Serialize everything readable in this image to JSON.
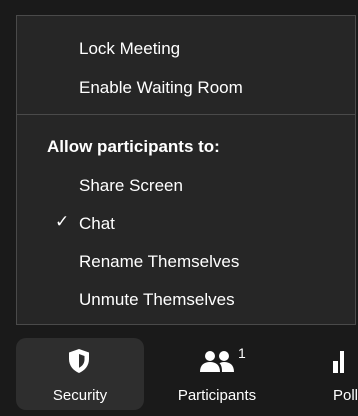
{
  "security_menu": {
    "items_top": [
      {
        "label": "Lock Meeting"
      },
      {
        "label": "Enable Waiting Room"
      }
    ],
    "section_title": "Allow participants to:",
    "permissions": [
      {
        "label": "Share Screen",
        "checked": false
      },
      {
        "label": "Chat",
        "checked": true
      },
      {
        "label": "Rename Themselves",
        "checked": false
      },
      {
        "label": "Unmute Themselves",
        "checked": false
      }
    ],
    "check_mark": "✓"
  },
  "toolbar": {
    "security": {
      "label": "Security",
      "icon": "shield-icon"
    },
    "participants": {
      "label": "Participants",
      "icon": "participants-icon",
      "count": "1"
    },
    "polls": {
      "label": "Polls",
      "icon": "bar-chart-icon"
    }
  },
  "colors": {
    "background": "#1a1a1a",
    "menu_background": "#262626",
    "menu_border": "#4a4a4a",
    "selected_tool_background": "#2e2e2e",
    "text": "#ffffff"
  }
}
